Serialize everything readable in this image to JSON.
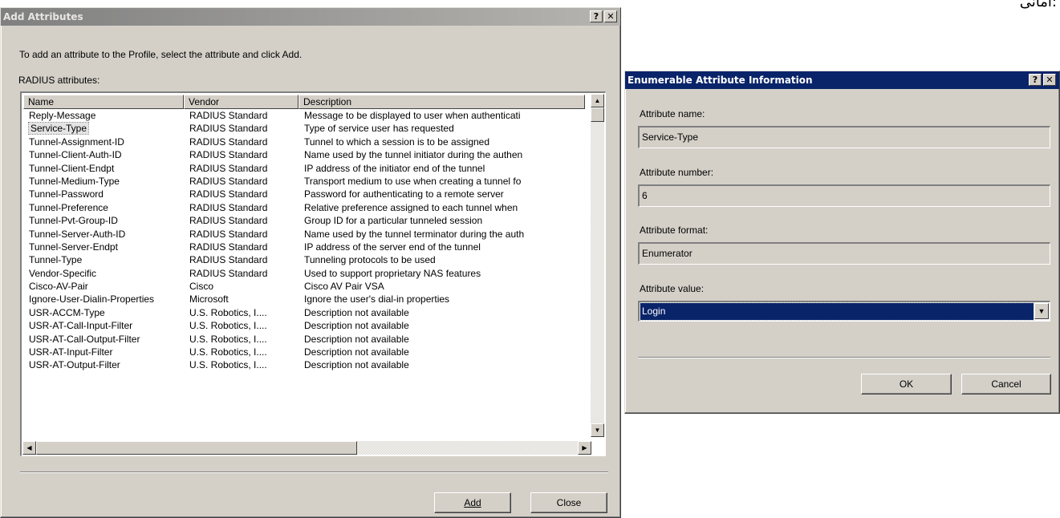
{
  "corner_text": "امانی:",
  "add_dialog": {
    "title": "Add Attributes",
    "help_button": "?",
    "close_button": "✕",
    "instruction": "To add an attribute to the Profile, select the attribute and click Add.",
    "list_label": "RADIUS attributes:",
    "columns": [
      "Name",
      "Vendor",
      "Description"
    ],
    "rows": [
      {
        "name": "Reply-Message",
        "vendor": "RADIUS Standard",
        "description": "Message to be displayed to user when authenticati"
      },
      {
        "name": "Service-Type",
        "vendor": "RADIUS Standard",
        "description": "Type of service user has requested",
        "selected": true
      },
      {
        "name": "Tunnel-Assignment-ID",
        "vendor": "RADIUS Standard",
        "description": "Tunnel to which a session is to be assigned"
      },
      {
        "name": "Tunnel-Client-Auth-ID",
        "vendor": "RADIUS Standard",
        "description": "Name used by the tunnel initiator during the authen"
      },
      {
        "name": "Tunnel-Client-Endpt",
        "vendor": "RADIUS Standard",
        "description": "IP address of the initiator end of the tunnel"
      },
      {
        "name": "Tunnel-Medium-Type",
        "vendor": "RADIUS Standard",
        "description": "Transport medium to use when creating a tunnel fo"
      },
      {
        "name": "Tunnel-Password",
        "vendor": "RADIUS Standard",
        "description": "Password for authenticating to a remote server"
      },
      {
        "name": "Tunnel-Preference",
        "vendor": "RADIUS Standard",
        "description": "Relative preference assigned to each tunnel when"
      },
      {
        "name": "Tunnel-Pvt-Group-ID",
        "vendor": "RADIUS Standard",
        "description": "Group ID for a particular tunneled session"
      },
      {
        "name": "Tunnel-Server-Auth-ID",
        "vendor": "RADIUS Standard",
        "description": "Name used by the tunnel terminator during the auth"
      },
      {
        "name": "Tunnel-Server-Endpt",
        "vendor": "RADIUS Standard",
        "description": "IP address of the server end of the tunnel"
      },
      {
        "name": "Tunnel-Type",
        "vendor": "RADIUS Standard",
        "description": "Tunneling protocols to be used"
      },
      {
        "name": "Vendor-Specific",
        "vendor": "RADIUS Standard",
        "description": "Used to support proprietary NAS features"
      },
      {
        "name": "Cisco-AV-Pair",
        "vendor": "Cisco",
        "description": "Cisco AV Pair VSA"
      },
      {
        "name": "Ignore-User-Dialin-Properties",
        "vendor": "Microsoft",
        "description": "Ignore the user's dial-in properties"
      },
      {
        "name": "USR-ACCM-Type",
        "vendor": "U.S. Robotics, I....",
        "description": "Description not available"
      },
      {
        "name": "USR-AT-Call-Input-Filter",
        "vendor": "U.S. Robotics, I....",
        "description": "Description not available"
      },
      {
        "name": "USR-AT-Call-Output-Filter",
        "vendor": "U.S. Robotics, I....",
        "description": "Description not available"
      },
      {
        "name": "USR-AT-Input-Filter",
        "vendor": "U.S. Robotics, I....",
        "description": "Description not available"
      },
      {
        "name": "USR-AT-Output-Filter",
        "vendor": "U.S. Robotics, I....",
        "description": "Description not available"
      }
    ],
    "add_button": "Add",
    "close_button_label": "Close"
  },
  "enum_dialog": {
    "title": "Enumerable Attribute Information",
    "help_button": "?",
    "close_button": "✕",
    "name_label": "Attribute name:",
    "name_value": "Service-Type",
    "number_label": "Attribute number:",
    "number_value": "6",
    "format_label": "Attribute format:",
    "format_value": "Enumerator",
    "value_label": "Attribute value:",
    "value_selected": "Login",
    "ok_button": "OK",
    "cancel_button": "Cancel"
  }
}
